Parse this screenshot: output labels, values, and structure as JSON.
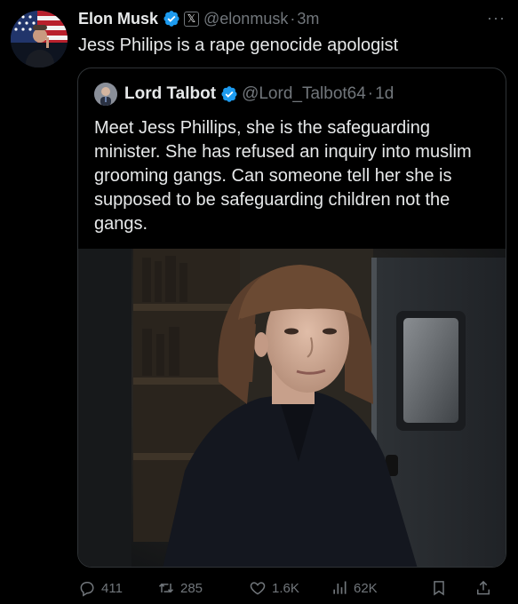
{
  "tweet": {
    "author_name": "Elon Musk",
    "handle": "@elonmusk",
    "separator": "·",
    "time": "3m",
    "more": "···",
    "x_badge": "𝕏",
    "text": "Jess Philips is a rape genocide apologist"
  },
  "quote": {
    "author_name": "Lord Talbot",
    "handle": "@Lord_Talbot64",
    "separator": "·",
    "time": "1d",
    "text": "Meet Jess Phillips, she is the safeguarding minister. She has refused an inquiry into muslim grooming gangs. Can someone tell her she is supposed to be safeguarding children not the gangs."
  },
  "actions": {
    "replies": "411",
    "reposts": "285",
    "likes": "1.6K",
    "views": "62K"
  },
  "colors": {
    "background": "#000000",
    "text": "#e7e9ea",
    "muted": "#71767b",
    "verified": "#1d9bf0",
    "border": "#2f3336"
  },
  "icons": [
    "verified-badge-icon",
    "x-badge-icon",
    "more-icon",
    "reply-icon",
    "repost-icon",
    "like-icon",
    "views-icon",
    "bookmark-icon",
    "share-icon"
  ]
}
